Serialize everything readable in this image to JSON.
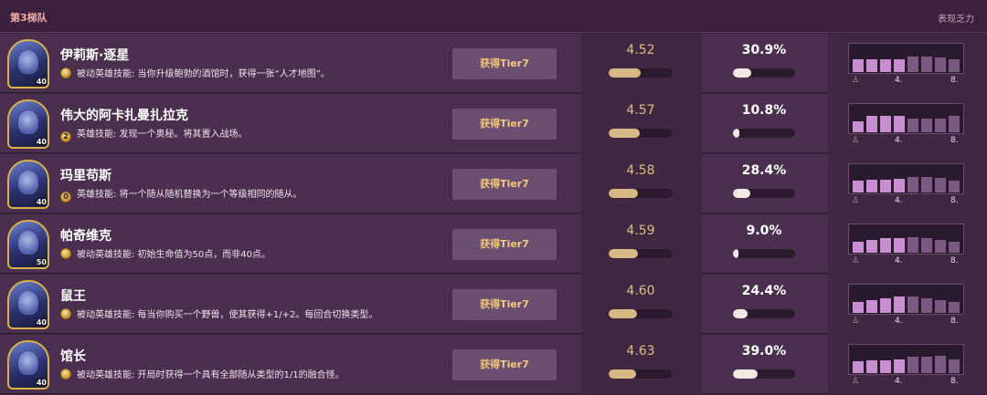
{
  "header": {
    "tier_title": "第3梯队",
    "right_label": "表现乏力"
  },
  "axis_labels": {
    "mid": "4.",
    "end": "8."
  },
  "trophy_glyph": "♙",
  "heroes": [
    {
      "name": "伊莉斯·逐星",
      "skill_cost": "",
      "skill": "被动英雄技能: 当你升级鲍勃的酒馆时，获得一张“人才地图”。",
      "hp": "40",
      "tier_button": "获得Tier7",
      "avg_place": "4.52",
      "avg_fill": 0.5,
      "pick_rate": "30.9%",
      "pick_fill": 0.3,
      "dist": [
        0.45,
        0.45,
        0.45,
        0.45,
        0.52,
        0.52,
        0.5,
        0.45
      ]
    },
    {
      "name": "伟大的阿卡扎曼扎拉克",
      "skill_cost": "2",
      "skill": "英雄技能: 发现一个奥秘。将其置入战场。",
      "hp": "40",
      "tier_button": "获得Tier7",
      "avg_place": "4.57",
      "avg_fill": 0.48,
      "pick_rate": "10.8%",
      "pick_fill": 0.1,
      "dist": [
        0.38,
        0.55,
        0.55,
        0.55,
        0.48,
        0.48,
        0.48,
        0.55
      ]
    },
    {
      "name": "玛里苟斯",
      "skill_cost": "0",
      "skill": "英雄技能: 将一个随从随机替换为一个等级相同的随从。",
      "hp": "40",
      "tier_button": "获得Tier7",
      "avg_place": "4.58",
      "avg_fill": 0.46,
      "pick_rate": "28.4%",
      "pick_fill": 0.28,
      "dist": [
        0.42,
        0.45,
        0.45,
        0.48,
        0.52,
        0.52,
        0.5,
        0.42
      ]
    },
    {
      "name": "帕奇维克",
      "skill_cost": "",
      "skill": "被动英雄技能: 初始生命值为50点，而非40点。",
      "hp": "50",
      "tier_button": "获得Tier7",
      "avg_place": "4.59",
      "avg_fill": 0.45,
      "pick_rate": "9.0%",
      "pick_fill": 0.09,
      "dist": [
        0.36,
        0.45,
        0.5,
        0.5,
        0.52,
        0.5,
        0.45,
        0.38
      ]
    },
    {
      "name": "鼠王",
      "skill_cost": "",
      "skill": "被动英雄技能: 每当你购买一个野兽，使其获得+1/+2。每回合切换类型。",
      "hp": "40",
      "tier_button": "获得Tier7",
      "avg_place": "4.60",
      "avg_fill": 0.44,
      "pick_rate": "24.4%",
      "pick_fill": 0.24,
      "dist": [
        0.38,
        0.45,
        0.5,
        0.55,
        0.55,
        0.5,
        0.45,
        0.38
      ]
    },
    {
      "name": "馆长",
      "skill_cost": "",
      "skill": "被动英雄技能: 开局时获得一个具有全部随从类型的1/1的融合怪。",
      "hp": "40",
      "tier_button": "获得Tier7",
      "avg_place": "4.63",
      "avg_fill": 0.43,
      "pick_rate": "39.0%",
      "pick_fill": 0.39,
      "dist": [
        0.42,
        0.45,
        0.45,
        0.48,
        0.55,
        0.55,
        0.58,
        0.48
      ]
    }
  ]
}
